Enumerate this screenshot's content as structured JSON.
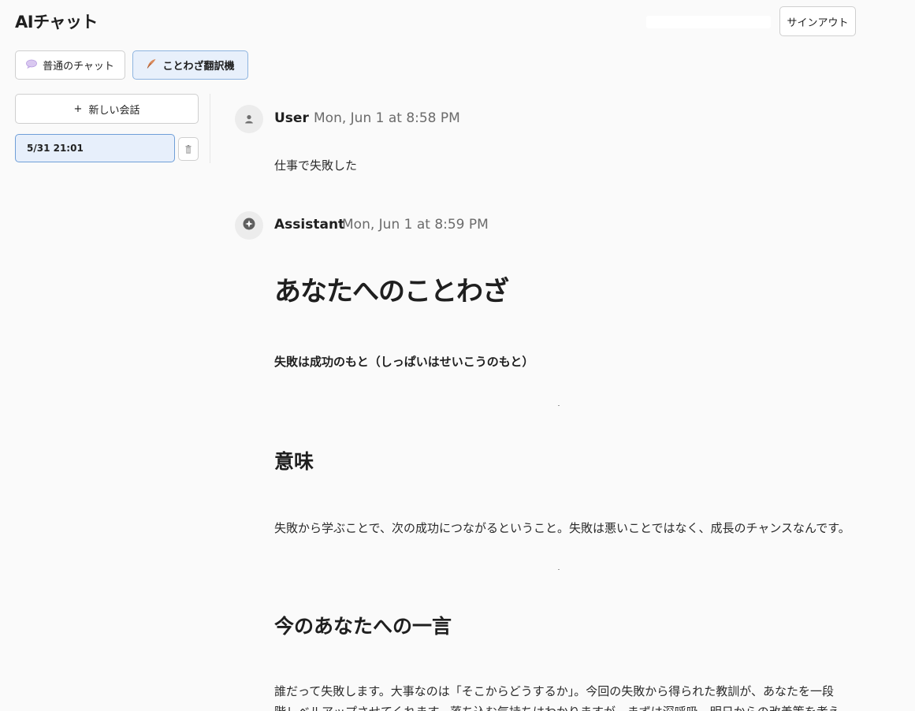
{
  "header": {
    "app_title": "AIチャット",
    "signout_label": "サインアウト"
  },
  "modes": [
    {
      "icon": "speech-bubble-icon",
      "label": "普通のチャット",
      "active": false
    },
    {
      "icon": "feather-icon",
      "label": "ことわざ翻訳機",
      "active": true
    }
  ],
  "sidebar": {
    "new_chat_label": "新しい会話",
    "conversations": [
      {
        "label": "5/31 21:01",
        "selected": true
      }
    ]
  },
  "messages": [
    {
      "author": "User",
      "time": "Mon, Jun 1 at 8:58 PM",
      "text": "仕事で失敗した"
    },
    {
      "author": "Assistant",
      "time": "Mon, Jun 1 at 8:59 PM",
      "title": "あなたへのことわざ",
      "proverb": "失敗は成功のもと（しっぱいはせいこうのもと）",
      "meaning_heading": "意味",
      "meaning_text": "失敗から学ぶことで、次の成功につながるということ。失敗は悪いことではなく、成長のチャンスなんです。",
      "advice_heading": "今のあなたへの一言",
      "advice_text": "誰だって失敗します。大事なのは「そこからどうするか」。今回の失敗から得られた教訓が、あなたを一段階レベルアップさせてくれます。落ち込む気持ちはわかりますが、まずは深呼吸。明日からの改善策を考え"
    }
  ],
  "colors": {
    "accent_bg": "#e8f0fb",
    "accent_border": "#8eb4e0",
    "page_bg": "#fafafa"
  }
}
